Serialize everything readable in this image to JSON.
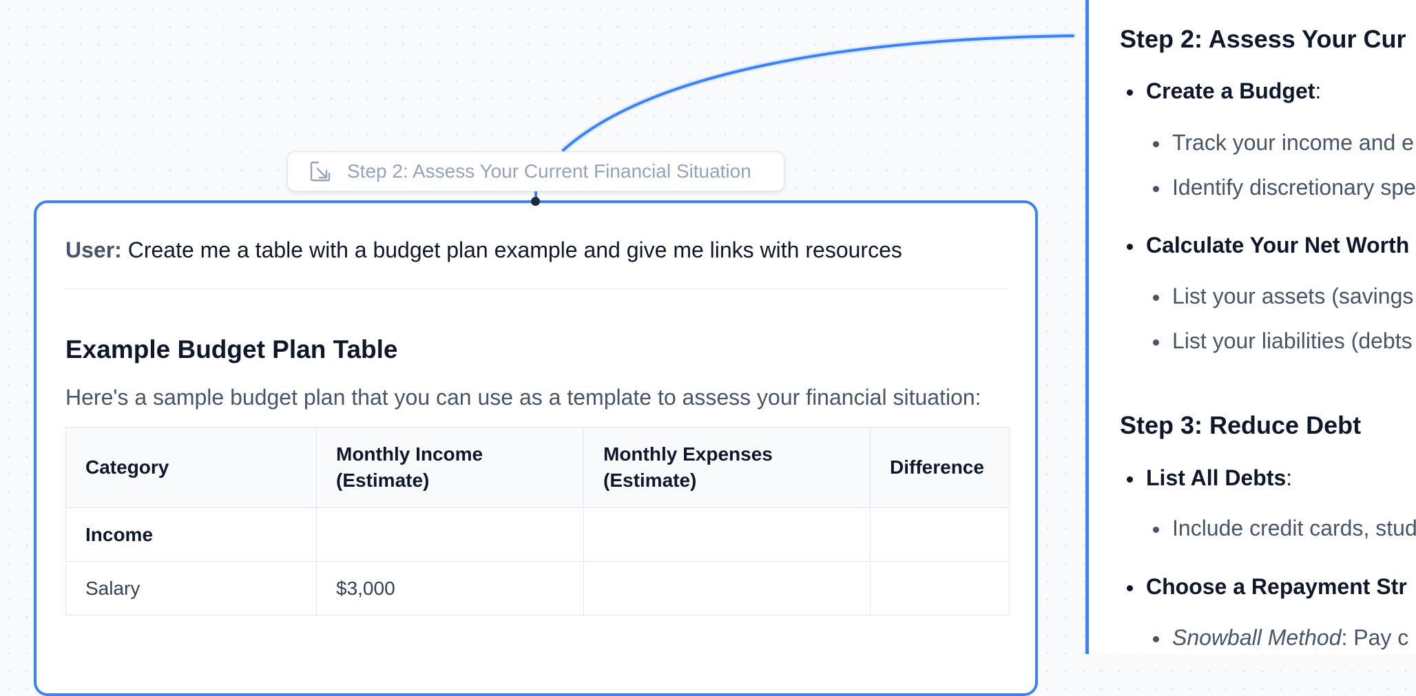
{
  "reference_chip": {
    "icon": "arrow-down-right-square-icon",
    "label": "Step 2: Assess Your Current Financial Situation"
  },
  "message": {
    "user_prefix": "User:",
    "user_text": "Create me a table with a budget plan example and give me links with resources",
    "heading": "Example Budget Plan Table",
    "intro": "Here's a sample budget plan that you can use as a template to assess your financial situation:",
    "table": {
      "headers": [
        "Category",
        "Monthly Income (Estimate)",
        "Monthly Expenses (Estimate)",
        "Difference"
      ],
      "rows": [
        [
          "Income",
          "",
          "",
          ""
        ],
        [
          "Salary",
          "$3,000",
          "",
          ""
        ]
      ]
    }
  },
  "side_panel": {
    "step2_title": "Step 2: Assess Your Cur",
    "budget_item": "Create a Budget",
    "budget_colon": ":",
    "track": "Track your income and e",
    "identify": "Identify discretionary spe",
    "net_worth": "Calculate Your Net Worth",
    "assets": "List your assets (savings",
    "liabilities": "List your liabilities (debts",
    "step3_title": "Step 3: Reduce Debt",
    "list_debts": "List All Debts",
    "list_debts_colon": ":",
    "include": "Include credit cards, stud",
    "repayment": "Choose a Repayment Str",
    "snowball_em": "Snowball Method",
    "snowball_rest": ": Pay c"
  },
  "colors": {
    "accent": "#3b82f6",
    "text_dark": "#0f172a",
    "text_muted": "#475569"
  }
}
